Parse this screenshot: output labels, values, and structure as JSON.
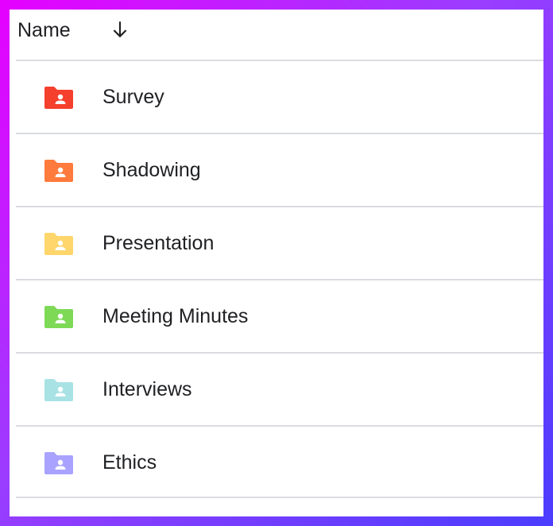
{
  "header": {
    "name_label": "Name",
    "sort_icon": "arrow-down-icon"
  },
  "folders": [
    {
      "label": "Survey",
      "color": "#f4402c",
      "icon": "shared-folder-icon"
    },
    {
      "label": "Shadowing",
      "color": "#ff7a3d",
      "icon": "shared-folder-icon"
    },
    {
      "label": "Presentation",
      "color": "#ffd66b",
      "icon": "shared-folder-icon"
    },
    {
      "label": "Meeting Minutes",
      "color": "#7ed957",
      "icon": "shared-folder-icon"
    },
    {
      "label": "Interviews",
      "color": "#a8e2e4",
      "icon": "shared-folder-icon"
    },
    {
      "label": "Ethics",
      "color": "#a9a3ff",
      "icon": "shared-folder-icon"
    }
  ]
}
